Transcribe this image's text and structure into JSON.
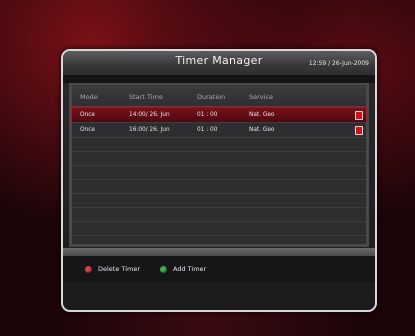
{
  "window": {
    "title": "Timer Manager",
    "clock": "12:59 / 26-Jun-2009"
  },
  "table": {
    "headers": [
      "Mode",
      "Start Time",
      "Duration",
      "Service"
    ],
    "rows": [
      {
        "mode": "Once",
        "start": "14:00/ 26. Jun",
        "duration": "01 : 00",
        "service": "Nat. Geo",
        "icon": "record-icon",
        "selected": true
      },
      {
        "mode": "Once",
        "start": "16:00/ 26. Jun",
        "duration": "01 : 00",
        "service": "Nat. Geo",
        "icon": "record-icon",
        "selected": false
      }
    ]
  },
  "footer": {
    "delete_label": "Delete Timer",
    "add_label": "Add Timer",
    "delete_color": "#d84040",
    "add_color": "#3fb04a"
  }
}
